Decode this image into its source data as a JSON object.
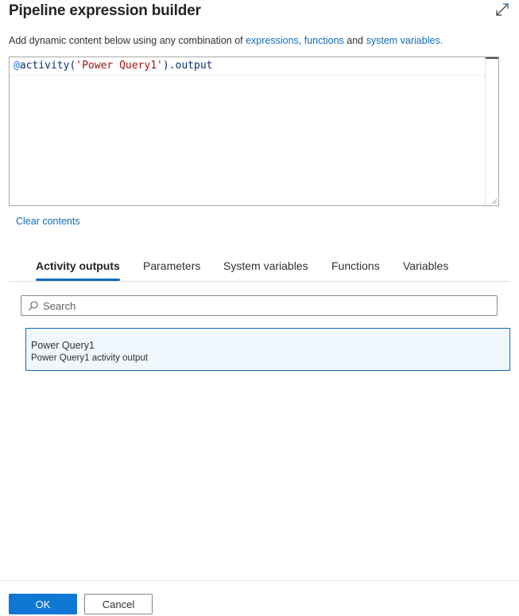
{
  "dialog": {
    "title": "Pipeline expression builder",
    "expand_icon": "expand-diagonal-icon"
  },
  "description": {
    "prefix": "Add dynamic content below using any combination of ",
    "link1": "expressions, functions",
    "middle": " and ",
    "link2": "system variables."
  },
  "editor": {
    "at": "@",
    "code_part1": "activity(",
    "code_string": "'Power Query1'",
    "code_part2": ").output"
  },
  "clear_label": "Clear contents",
  "tabs": [
    {
      "label": "Activity outputs",
      "active": true
    },
    {
      "label": "Parameters",
      "active": false
    },
    {
      "label": "System variables",
      "active": false
    },
    {
      "label": "Functions",
      "active": false
    },
    {
      "label": "Variables",
      "active": false
    }
  ],
  "search": {
    "placeholder": "Search",
    "value": "",
    "icon": "search-icon"
  },
  "items": [
    {
      "name": "Power Query1",
      "description": "Power Query1 activity output",
      "selected": true
    }
  ],
  "footer": {
    "ok_label": "OK",
    "cancel_label": "Cancel"
  },
  "colors": {
    "accent": "#0f6cbd",
    "primary_button": "#0f78d4",
    "selected_item_bg": "#eff6fc",
    "string_literal": "#a31515"
  }
}
